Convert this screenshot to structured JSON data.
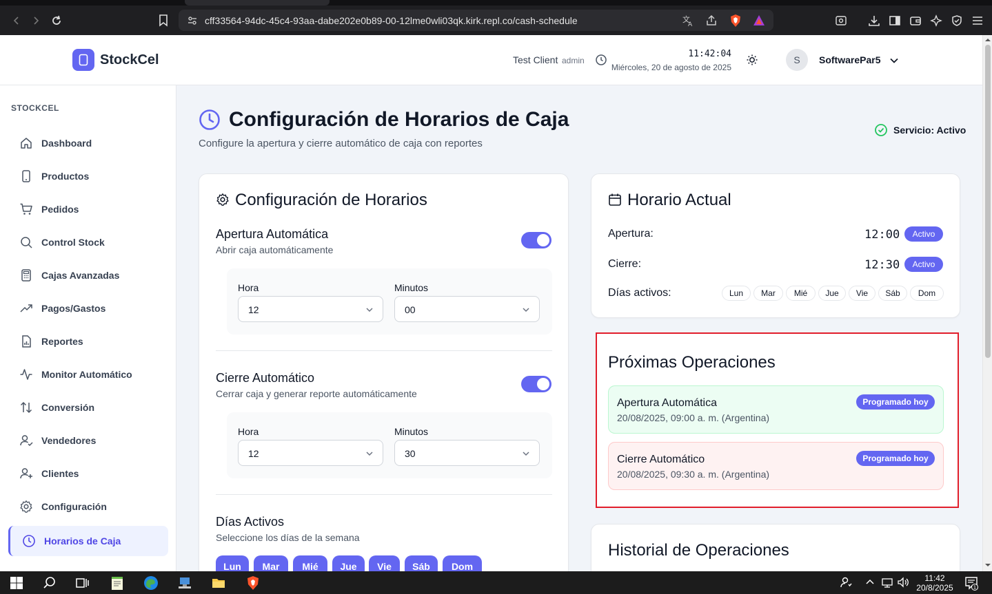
{
  "browser": {
    "url": "cff33564-94dc-45c4-93aa-dabe202e0b89-00-12lme0wli03qk.kirk.repl.co/cash-schedule"
  },
  "header": {
    "brand": "StockCel",
    "client": "Test Client",
    "role": "admin",
    "time": "11:42:04",
    "date": "Miércoles, 20 de agosto de 2025",
    "avatar_initial": "S",
    "user": "SoftwarePar5"
  },
  "sidebar": {
    "section": "STOCKCEL",
    "items": [
      {
        "label": "Dashboard",
        "icon": "home-icon"
      },
      {
        "label": "Productos",
        "icon": "phone-icon"
      },
      {
        "label": "Pedidos",
        "icon": "cart-icon"
      },
      {
        "label": "Control Stock",
        "icon": "search-icon"
      },
      {
        "label": "Cajas Avanzadas",
        "icon": "calculator-icon"
      },
      {
        "label": "Pagos/Gastos",
        "icon": "trending-up-icon"
      },
      {
        "label": "Reportes",
        "icon": "report-icon"
      },
      {
        "label": "Monitor Automático",
        "icon": "activity-icon"
      },
      {
        "label": "Conversión",
        "icon": "arrows-updown-icon"
      },
      {
        "label": "Vendedores",
        "icon": "user-check-icon"
      },
      {
        "label": "Clientes",
        "icon": "user-plus-icon"
      },
      {
        "label": "Configuración",
        "icon": "gear-icon"
      },
      {
        "label": "Horarios de Caja",
        "icon": "clock-icon",
        "active": true
      }
    ]
  },
  "page": {
    "title": "Configuración de Horarios de Caja",
    "subtitle": "Configure la apertura y cierre automático de caja con reportes",
    "service_status": "Servicio: Activo"
  },
  "config": {
    "title": "Configuración de Horarios",
    "opening": {
      "title": "Apertura Automática",
      "subtitle": "Abrir caja automáticamente",
      "enabled": true,
      "hour_label": "Hora",
      "hour": "12",
      "minutes_label": "Minutos",
      "minutes": "00"
    },
    "closing": {
      "title": "Cierre Automático",
      "subtitle": "Cerrar caja y generar reporte automáticamente",
      "enabled": true,
      "hour_label": "Hora",
      "hour": "12",
      "minutes_label": "Minutos",
      "minutes": "30"
    },
    "days": {
      "title": "Días Activos",
      "subtitle": "Seleccione los días de la semana",
      "items": [
        "Lun",
        "Mar",
        "Mié",
        "Jue",
        "Vie",
        "Sáb",
        "Dom"
      ]
    }
  },
  "current": {
    "title": "Horario Actual",
    "opening_label": "Apertura:",
    "opening_time": "12:00",
    "opening_status": "Activo",
    "closing_label": "Cierre:",
    "closing_time": "12:30",
    "closing_status": "Activo",
    "days_label": "Días activos:",
    "days": [
      "Lun",
      "Mar",
      "Mié",
      "Jue",
      "Vie",
      "Sáb",
      "Dom"
    ]
  },
  "upcoming": {
    "title": "Próximas Operaciones",
    "ops": [
      {
        "name": "Apertura Automática",
        "when": "20/08/2025, 09:00 a. m. (Argentina)",
        "badge": "Programado hoy"
      },
      {
        "name": "Cierre Automático",
        "when": "20/08/2025, 09:30 a. m. (Argentina)",
        "badge": "Programado hoy"
      }
    ]
  },
  "history": {
    "title": "Historial de Operaciones"
  },
  "taskbar": {
    "time": "11:42",
    "date": "20/8/2025",
    "notifications": "1"
  },
  "colors": {
    "accent": "#6366f1",
    "highlight_border": "#e11d2a",
    "success": "#22c55e"
  }
}
